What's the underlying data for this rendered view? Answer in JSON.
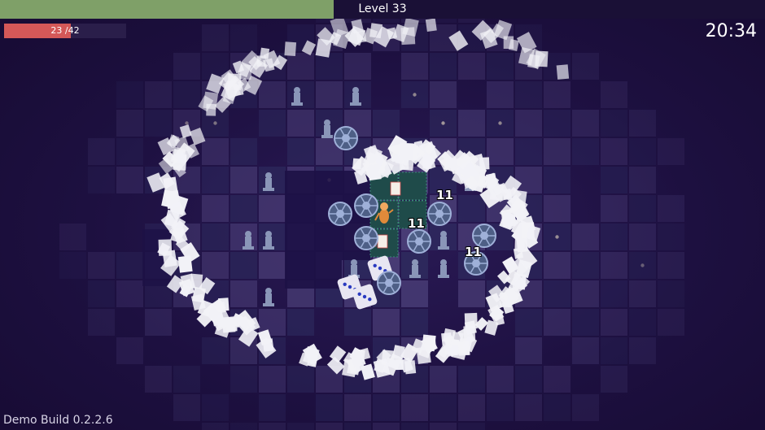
{
  "hud": {
    "level_label": "Level 33",
    "xp_fraction": 0.436,
    "hp_label": "23 /42",
    "hp_current": 23,
    "hp_max": 42,
    "timer": "20:34",
    "build_label": "Demo Build 0.2.2.6"
  },
  "damage_numbers": [
    {
      "text": "11"
    },
    {
      "text": "11"
    },
    {
      "text": "11"
    }
  ],
  "colors": {
    "xp_fill": "#7fa068",
    "hp_fill": "#d45858",
    "board_dark": "#2e2a5e",
    "board_light": "#4b3f78",
    "card_white": "#f2f2f7"
  }
}
